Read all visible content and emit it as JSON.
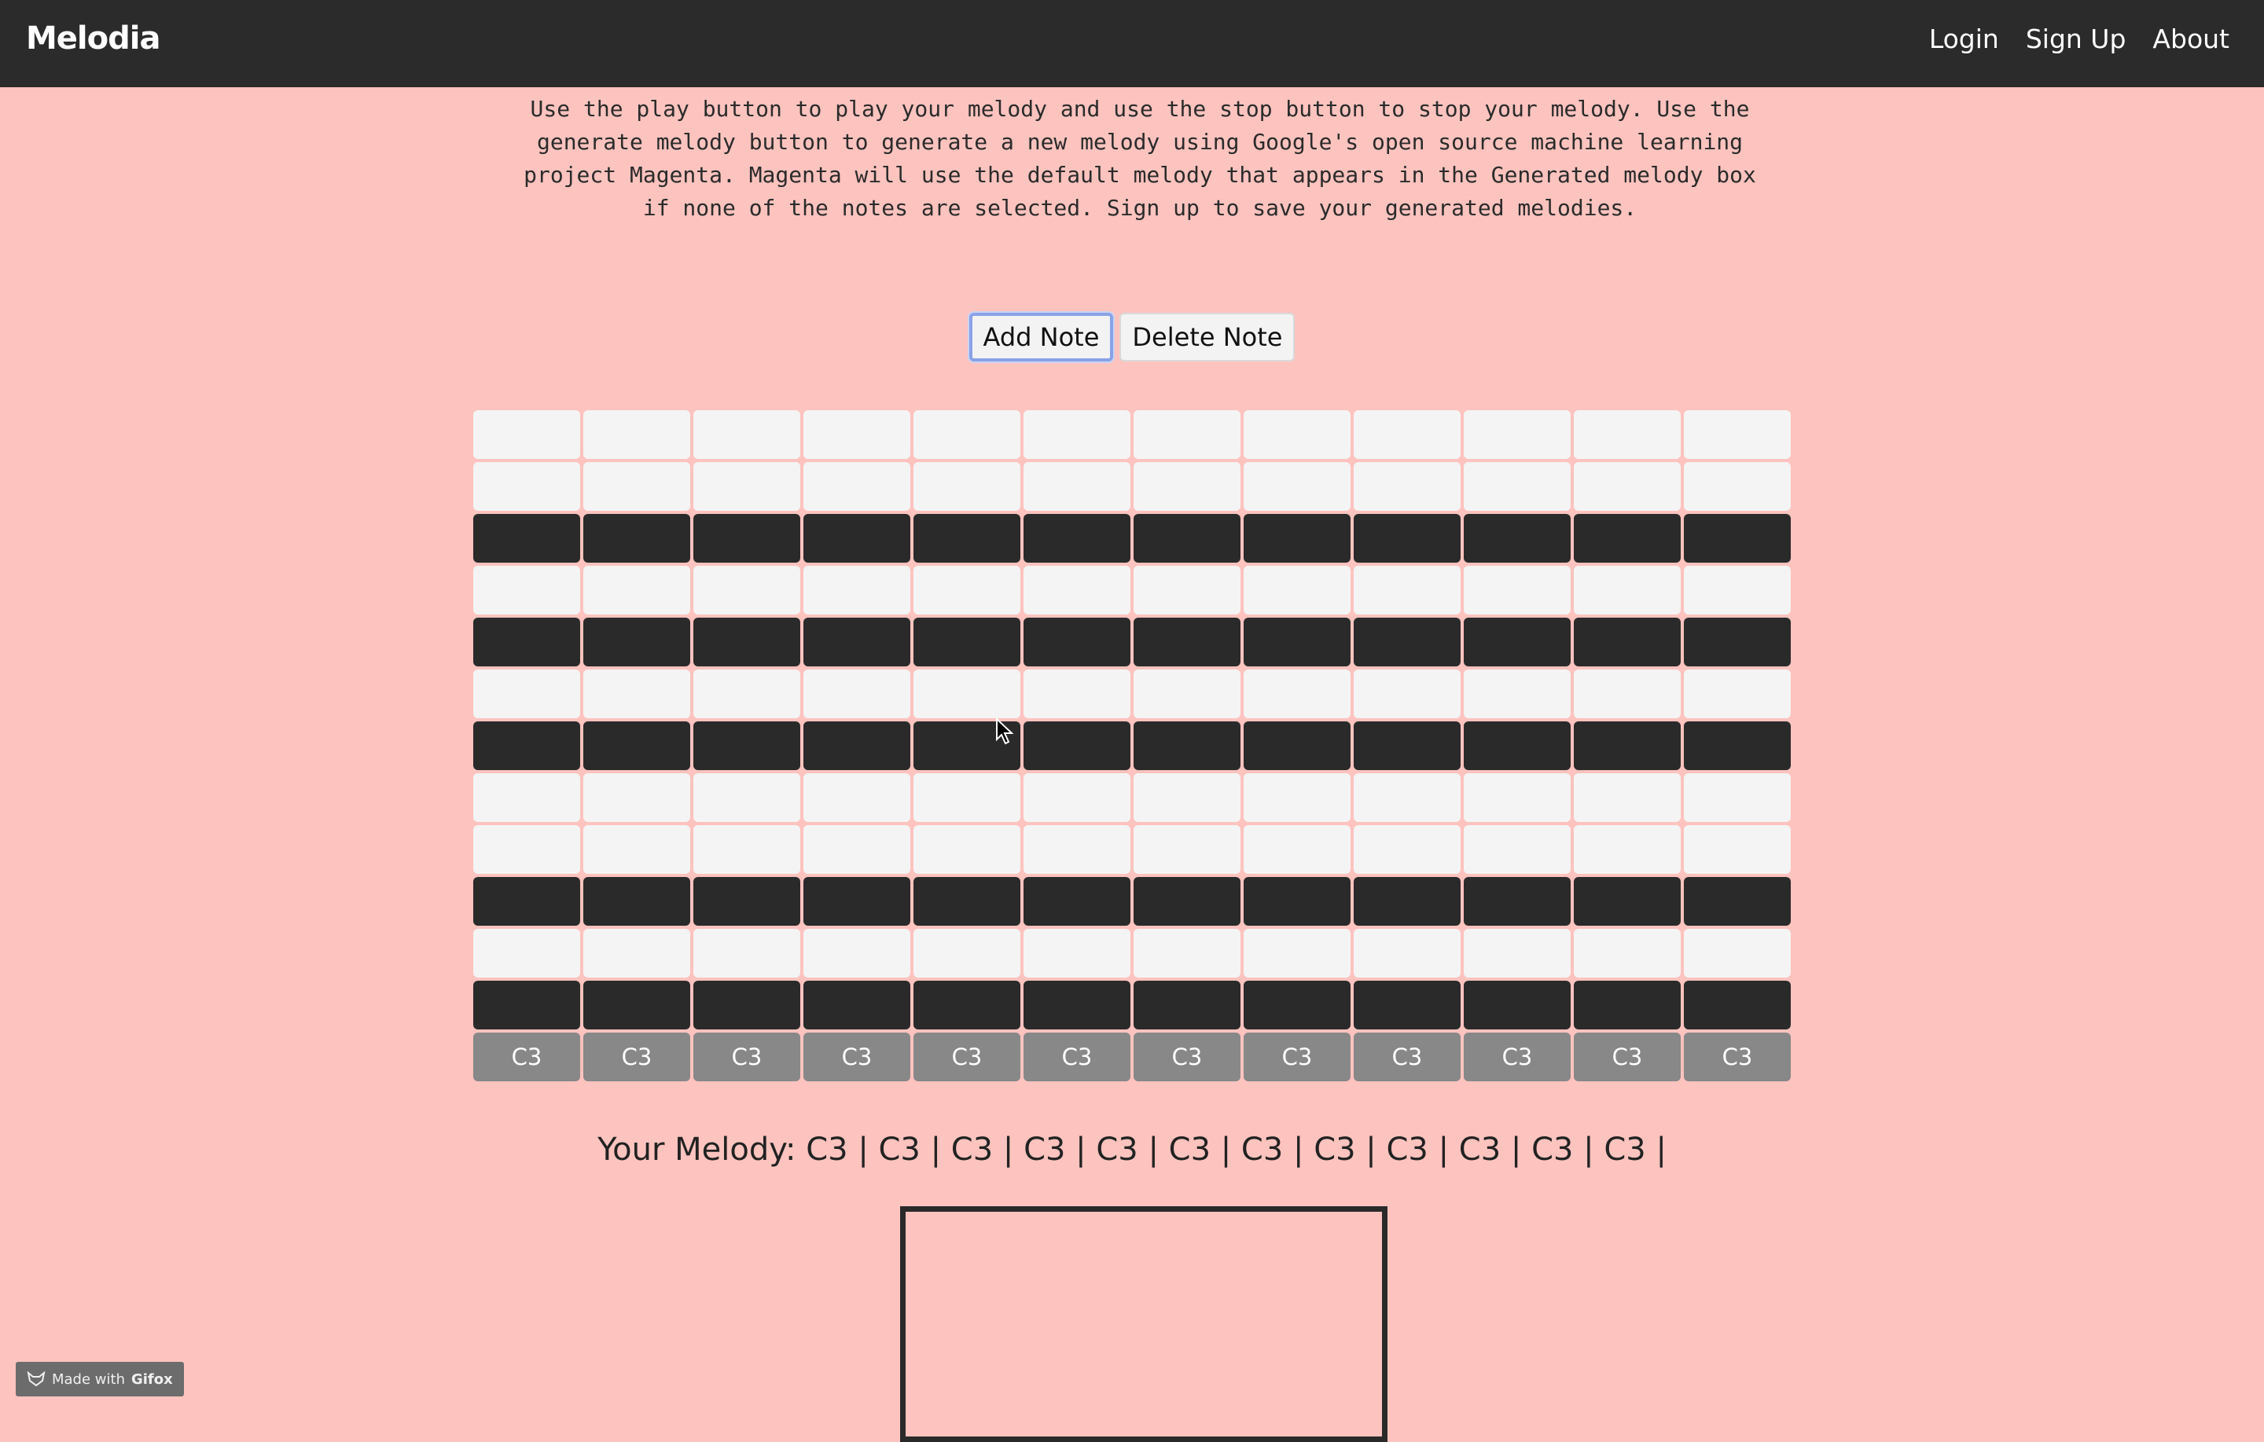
{
  "nav": {
    "brand": "Melodia",
    "links": [
      "Login",
      "Sign Up",
      "About"
    ]
  },
  "intro": {
    "text": "Use the play button to play your melody and use the stop button to stop your melody. Use the\ngenerate melody button to generate a new melody using Google's open source machine learning\nproject Magenta. Magenta will use the default melody that appears in the Generated melody box\nif none of the notes are selected. Sign up to save your generated melodies."
  },
  "controls": {
    "add_note": "Add Note",
    "delete_note": "Delete Note"
  },
  "grid": {
    "rows": [
      "white",
      "white",
      "black",
      "white",
      "black",
      "white",
      "black",
      "white",
      "white",
      "black",
      "white",
      "black"
    ],
    "columns": 12,
    "notes": [
      "C3",
      "C3",
      "C3",
      "C3",
      "C3",
      "C3",
      "C3",
      "C3",
      "C3",
      "C3",
      "C3",
      "C3"
    ]
  },
  "melody": {
    "text": "Your Melody: C3 | C3 | C3 | C3 | C3 | C3 | C3 | C3 | C3 | C3 | C3 | C3 |"
  },
  "badge": {
    "prefix": "Made with",
    "name": "Gifox"
  },
  "colors": {
    "background": "#fdc3bf",
    "navbar": "#2b2b2b",
    "white_key": "#f4f4f4",
    "black_key": "#2a2a2a",
    "note_cell": "#888888"
  }
}
